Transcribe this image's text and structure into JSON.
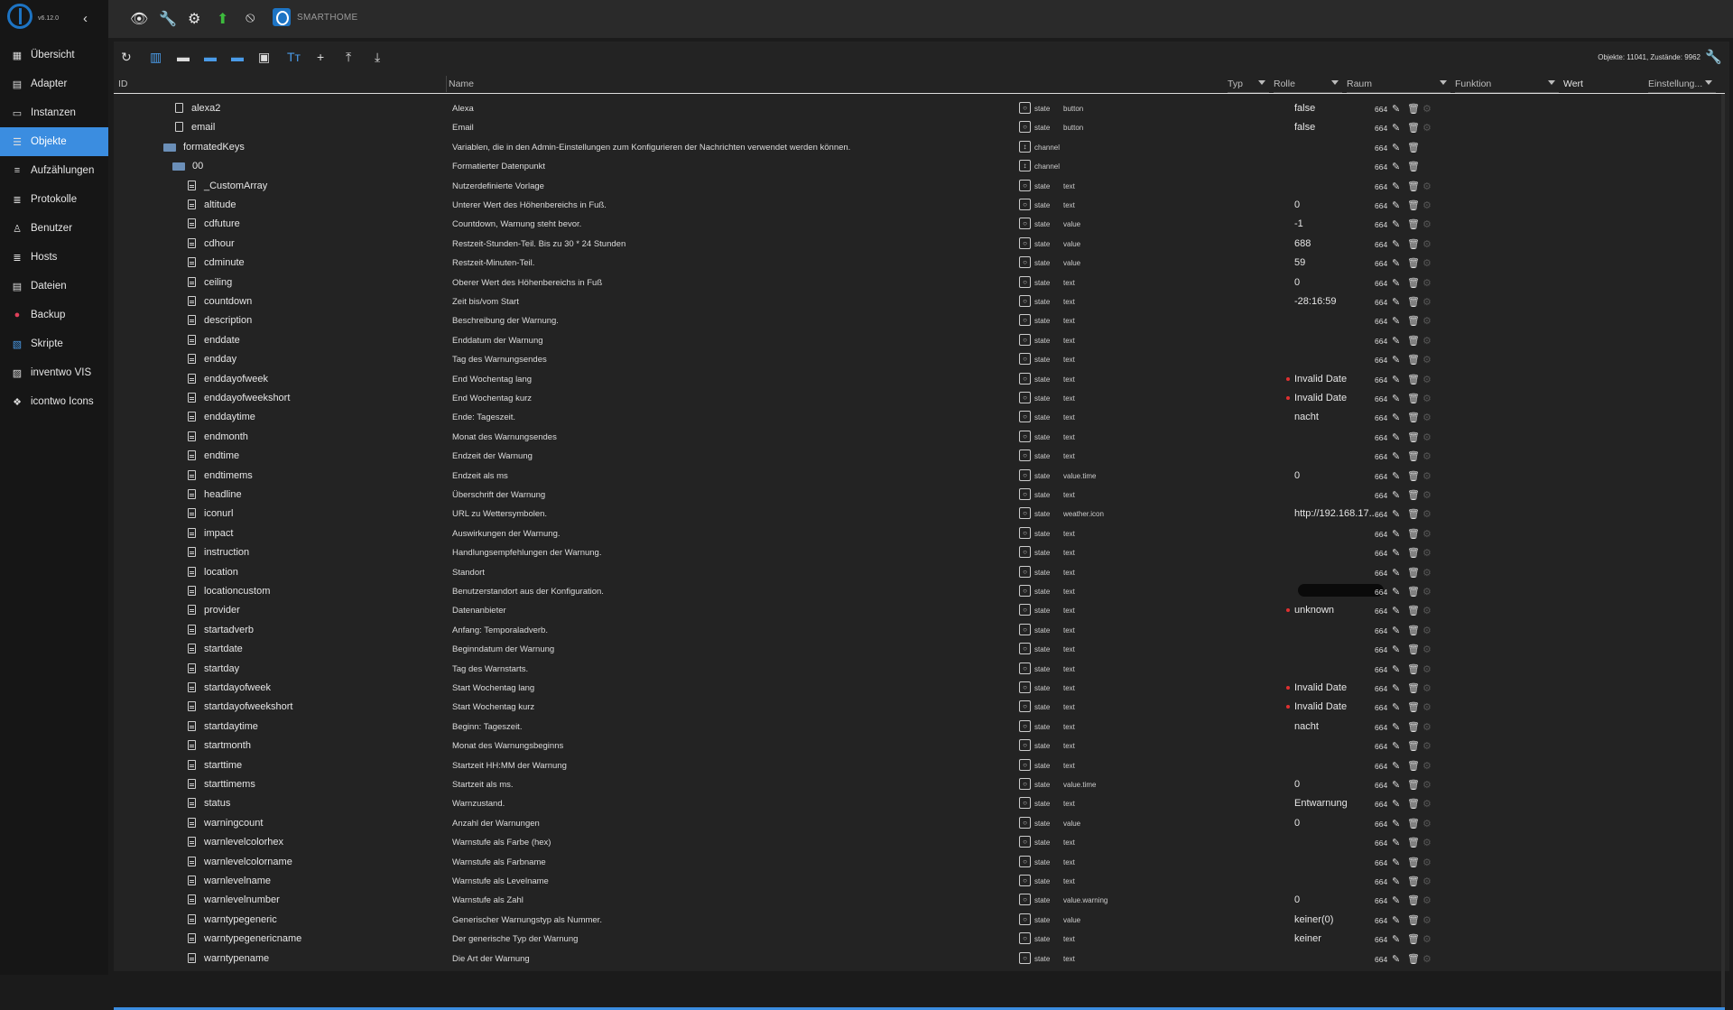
{
  "app": {
    "version": "v6.12.0",
    "brand": "SMARTHOME",
    "object_count": "Objekte: 11041, Zustände: 9962"
  },
  "sidebar": {
    "items": [
      {
        "label": "Übersicht",
        "icon": "grid-icon"
      },
      {
        "label": "Adapter",
        "icon": "store-icon"
      },
      {
        "label": "Instanzen",
        "icon": "instances-icon"
      },
      {
        "label": "Objekte",
        "icon": "list-icon",
        "active": true
      },
      {
        "label": "Aufzählungen",
        "icon": "enum-icon"
      },
      {
        "label": "Protokolle",
        "icon": "log-icon"
      },
      {
        "label": "Benutzer",
        "icon": "user-icon"
      },
      {
        "label": "Hosts",
        "icon": "hosts-icon"
      },
      {
        "label": "Dateien",
        "icon": "file-icon"
      },
      {
        "label": "Backup",
        "icon": "backup-icon"
      },
      {
        "label": "Skripte",
        "icon": "script-icon"
      },
      {
        "label": "inventwo VIS",
        "icon": "vis-icon"
      },
      {
        "label": "icontwo Icons",
        "icon": "icons-icon"
      }
    ]
  },
  "columns": {
    "id": "ID",
    "name": "Name",
    "type": "Typ",
    "role": "Rolle",
    "room": "Raum",
    "func": "Funktion",
    "value": "Wert",
    "settings": "Einstellung..."
  },
  "rows": [
    {
      "id": "alexa2",
      "level": 1,
      "kind": "plain",
      "name": "Alexa",
      "type": "state",
      "role": "button",
      "value": "false",
      "acl": "664"
    },
    {
      "id": "email",
      "level": 1,
      "kind": "plain",
      "name": "Email",
      "type": "state",
      "role": "button",
      "value": "false",
      "acl": "664"
    },
    {
      "id": "formatedKeys",
      "level": 0,
      "kind": "folder",
      "name": "Variablen, die in den Admin-Einstellungen zum Konfigurieren der Nachrichten verwendet werden können.",
      "type": "channel",
      "role": "",
      "value": "",
      "acl": "664"
    },
    {
      "id": "00",
      "level": 0.5,
      "kind": "folder",
      "name": "Formatierter Datenpunkt",
      "type": "channel",
      "role": "",
      "value": "",
      "acl": "664"
    },
    {
      "id": "_CustomArray",
      "level": 2,
      "kind": "doc",
      "name": "Nutzerdefinierte Vorlage",
      "type": "state",
      "role": "text",
      "value": "",
      "acl": "664"
    },
    {
      "id": "altitude",
      "level": 2,
      "kind": "doc",
      "name": "Unterer Wert des Höhenbereichs in Fuß.",
      "type": "state",
      "role": "text",
      "value": "0",
      "acl": "664"
    },
    {
      "id": "cdfuture",
      "level": 2,
      "kind": "doc",
      "name": "Countdown, Warnung steht bevor.",
      "type": "state",
      "role": "value",
      "value": "-1",
      "acl": "664"
    },
    {
      "id": "cdhour",
      "level": 2,
      "kind": "doc",
      "name": "Restzeit-Stunden-Teil. Bis zu 30 * 24 Stunden",
      "type": "state",
      "role": "value",
      "value": "688",
      "acl": "664"
    },
    {
      "id": "cdminute",
      "level": 2,
      "kind": "doc",
      "name": "Restzeit-Minuten-Teil.",
      "type": "state",
      "role": "value",
      "value": "59",
      "acl": "664"
    },
    {
      "id": "ceiling",
      "level": 2,
      "kind": "doc",
      "name": "Oberer Wert des Höhenbereichs in Fuß",
      "type": "state",
      "role": "text",
      "value": "0",
      "acl": "664"
    },
    {
      "id": "countdown",
      "level": 2,
      "kind": "doc",
      "name": "Zeit bis/vom Start",
      "type": "state",
      "role": "text",
      "value": "-28:16:59",
      "acl": "664"
    },
    {
      "id": "description",
      "level": 2,
      "kind": "doc",
      "name": "Beschreibung der Warnung.",
      "type": "state",
      "role": "text",
      "value": "",
      "acl": "664"
    },
    {
      "id": "enddate",
      "level": 2,
      "kind": "doc",
      "name": "Enddatum der Warnung",
      "type": "state",
      "role": "text",
      "value": "",
      "acl": "664"
    },
    {
      "id": "endday",
      "level": 2,
      "kind": "doc",
      "name": "Tag des Warnungsendes",
      "type": "state",
      "role": "text",
      "value": "",
      "acl": "664"
    },
    {
      "id": "enddayofweek",
      "level": 2,
      "kind": "doc",
      "name": "End Wochentag lang",
      "type": "state",
      "role": "text",
      "value": "Invalid Date",
      "dot": true,
      "acl": "664"
    },
    {
      "id": "enddayofweekshort",
      "level": 2,
      "kind": "doc",
      "name": "End Wochentag kurz",
      "type": "state",
      "role": "text",
      "value": "Invalid Date",
      "dot": true,
      "acl": "664"
    },
    {
      "id": "enddaytime",
      "level": 2,
      "kind": "doc",
      "name": "Ende: Tageszeit.",
      "type": "state",
      "role": "text",
      "value": "nacht",
      "acl": "664"
    },
    {
      "id": "endmonth",
      "level": 2,
      "kind": "doc",
      "name": "Monat des Warnungsendes",
      "type": "state",
      "role": "text",
      "value": "",
      "acl": "664"
    },
    {
      "id": "endtime",
      "level": 2,
      "kind": "doc",
      "name": "Endzeit der Warnung",
      "type": "state",
      "role": "text",
      "value": "",
      "acl": "664"
    },
    {
      "id": "endtimems",
      "level": 2,
      "kind": "doc",
      "name": "Endzeit als ms",
      "type": "state",
      "role": "value.time",
      "value": "0",
      "acl": "664"
    },
    {
      "id": "headline",
      "level": 2,
      "kind": "doc",
      "name": "Überschrift der Warnung",
      "type": "state",
      "role": "text",
      "value": "",
      "acl": "664"
    },
    {
      "id": "iconurl",
      "level": 2,
      "kind": "doc",
      "name": "URL zu Wettersymbolen.",
      "type": "state",
      "role": "weather.icon",
      "value": "http://192.168.17...",
      "acl": "664"
    },
    {
      "id": "impact",
      "level": 2,
      "kind": "doc",
      "name": "Auswirkungen der Warnung.",
      "type": "state",
      "role": "text",
      "value": "",
      "acl": "664"
    },
    {
      "id": "instruction",
      "level": 2,
      "kind": "doc",
      "name": "Handlungsempfehlungen der Warnung.",
      "type": "state",
      "role": "text",
      "value": "",
      "acl": "664"
    },
    {
      "id": "location",
      "level": 2,
      "kind": "doc",
      "name": "Standort",
      "type": "state",
      "role": "text",
      "value": "",
      "acl": "664"
    },
    {
      "id": "locationcustom",
      "level": 2,
      "kind": "doc",
      "name": "Benutzerstandort aus der Konfiguration.",
      "type": "state",
      "role": "text",
      "value": "",
      "redacted": true,
      "acl": "664"
    },
    {
      "id": "provider",
      "level": 2,
      "kind": "doc",
      "name": "Datenanbieter",
      "type": "state",
      "role": "text",
      "value": "unknown",
      "dot": true,
      "acl": "664"
    },
    {
      "id": "startadverb",
      "level": 2,
      "kind": "doc",
      "name": "Anfang: Temporaladverb.",
      "type": "state",
      "role": "text",
      "value": "",
      "acl": "664"
    },
    {
      "id": "startdate",
      "level": 2,
      "kind": "doc",
      "name": "Beginndatum der Warnung",
      "type": "state",
      "role": "text",
      "value": "",
      "acl": "664"
    },
    {
      "id": "startday",
      "level": 2,
      "kind": "doc",
      "name": "Tag des Warnstarts.",
      "type": "state",
      "role": "text",
      "value": "",
      "acl": "664"
    },
    {
      "id": "startdayofweek",
      "level": 2,
      "kind": "doc",
      "name": "Start Wochentag lang",
      "type": "state",
      "role": "text",
      "value": "Invalid Date",
      "dot": true,
      "acl": "664"
    },
    {
      "id": "startdayofweekshort",
      "level": 2,
      "kind": "doc",
      "name": "Start Wochentag kurz",
      "type": "state",
      "role": "text",
      "value": "Invalid Date",
      "dot": true,
      "acl": "664"
    },
    {
      "id": "startdaytime",
      "level": 2,
      "kind": "doc",
      "name": "Beginn: Tageszeit.",
      "type": "state",
      "role": "text",
      "value": "nacht",
      "acl": "664"
    },
    {
      "id": "startmonth",
      "level": 2,
      "kind": "doc",
      "name": "Monat des Warnungsbeginns",
      "type": "state",
      "role": "text",
      "value": "",
      "acl": "664"
    },
    {
      "id": "starttime",
      "level": 2,
      "kind": "doc",
      "name": "Startzeit HH:MM der Warnung",
      "type": "state",
      "role": "text",
      "value": "",
      "acl": "664"
    },
    {
      "id": "starttimems",
      "level": 2,
      "kind": "doc",
      "name": "Startzeit als ms.",
      "type": "state",
      "role": "value.time",
      "value": "0",
      "acl": "664"
    },
    {
      "id": "status",
      "level": 2,
      "kind": "doc",
      "name": "Warnzustand.",
      "type": "state",
      "role": "text",
      "value": "Entwarnung",
      "acl": "664"
    },
    {
      "id": "warningcount",
      "level": 2,
      "kind": "doc",
      "name": "Anzahl der Warnungen",
      "type": "state",
      "role": "value",
      "value": "0",
      "acl": "664"
    },
    {
      "id": "warnlevelcolorhex",
      "level": 2,
      "kind": "doc",
      "name": "Warnstufe als Farbe (hex)",
      "type": "state",
      "role": "text",
      "value": "",
      "acl": "664"
    },
    {
      "id": "warnlevelcolorname",
      "level": 2,
      "kind": "doc",
      "name": "Warnstufe als Farbname",
      "type": "state",
      "role": "text",
      "value": "",
      "acl": "664"
    },
    {
      "id": "warnlevelname",
      "level": 2,
      "kind": "doc",
      "name": "Warnstufe als Levelname",
      "type": "state",
      "role": "text",
      "value": "",
      "acl": "664"
    },
    {
      "id": "warnlevelnumber",
      "level": 2,
      "kind": "doc",
      "name": "Warnstufe als Zahl",
      "type": "state",
      "role": "value.warning",
      "value": "0",
      "acl": "664"
    },
    {
      "id": "warntypegeneric",
      "level": 2,
      "kind": "doc",
      "name": "Generischer Warnungstyp als Nummer.",
      "type": "state",
      "role": "value",
      "value": "keiner(0)",
      "acl": "664"
    },
    {
      "id": "warntypegenericname",
      "level": 2,
      "kind": "doc",
      "name": "Der generische Typ der Warnung",
      "type": "state",
      "role": "text",
      "value": "keiner",
      "acl": "664"
    },
    {
      "id": "warntypename",
      "level": 2,
      "kind": "doc",
      "name": "Die Art der Warnung",
      "type": "state",
      "role": "text",
      "value": "",
      "acl": "664"
    }
  ]
}
